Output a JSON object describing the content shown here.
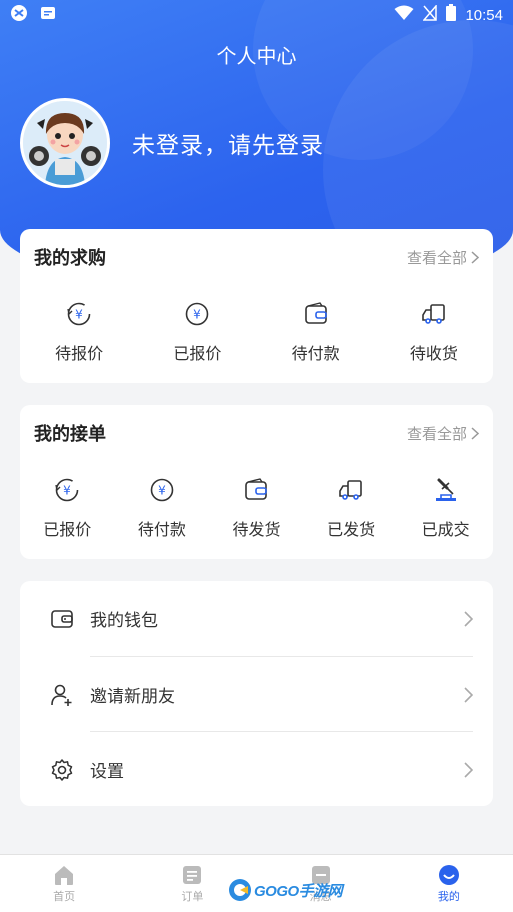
{
  "status_bar": {
    "time": "10:54"
  },
  "header": {
    "title": "个人中心",
    "login_prompt": "未登录，请先登录"
  },
  "purchase_section": {
    "title": "我的求购",
    "see_all": "查看全部",
    "items": [
      {
        "label": "待报价",
        "icon": "yen-refresh-icon"
      },
      {
        "label": "已报价",
        "icon": "yen-circle-icon"
      },
      {
        "label": "待付款",
        "icon": "wallet-icon"
      },
      {
        "label": "待收货",
        "icon": "truck-icon"
      }
    ]
  },
  "order_section": {
    "title": "我的接单",
    "see_all": "查看全部",
    "items": [
      {
        "label": "已报价",
        "icon": "yen-refresh-icon"
      },
      {
        "label": "待付款",
        "icon": "yen-circle-icon"
      },
      {
        "label": "待发货",
        "icon": "wallet-icon"
      },
      {
        "label": "已发货",
        "icon": "truck-icon"
      },
      {
        "label": "已成交",
        "icon": "gavel-icon"
      }
    ]
  },
  "menu": [
    {
      "label": "我的钱包",
      "icon": "wallet-icon"
    },
    {
      "label": "邀请新朋友",
      "icon": "add-user-icon"
    },
    {
      "label": "设置",
      "icon": "gear-icon"
    }
  ],
  "tabbar": [
    {
      "label": "首页",
      "icon": "home-icon"
    },
    {
      "label": "订单",
      "icon": "order-icon"
    },
    {
      "label": "消息",
      "icon": "message-icon"
    },
    {
      "label": "我的",
      "icon": "profile-icon",
      "active": true
    }
  ],
  "watermark": {
    "brand": "GOGO手游网"
  },
  "colors": {
    "primary": "#2a62ec",
    "background": "#f3f4f6",
    "text": "#333333",
    "muted": "#999999"
  }
}
